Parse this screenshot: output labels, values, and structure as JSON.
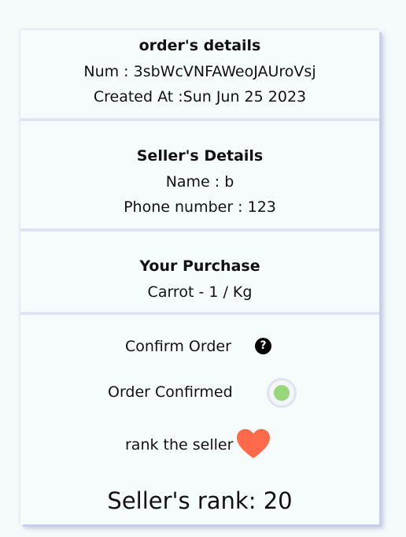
{
  "order": {
    "title": "order's details",
    "num_line": "Num : 3sbWcVNFAWeoJAUroVsj",
    "created_line": "Created At :Sun Jun 25 2023"
  },
  "seller": {
    "title": "Seller's Details",
    "name_line": "Name : b",
    "phone_line": "Phone number : 123"
  },
  "purchase": {
    "title": "Your Purchase",
    "item_line": "Carrot - 1 / Kg"
  },
  "actions": {
    "confirm_label": "Confirm Order",
    "help_glyph": "?",
    "confirmed_label": "Order Confirmed",
    "confirmed_on": true,
    "rank_label": "rank the seller",
    "rank_result": "Seller's rank: 20"
  },
  "icons": {
    "help": "question-circle-icon",
    "heart": "heart-icon"
  },
  "colors": {
    "toggle_on": "#97d77a",
    "heart": "#ff6b4a"
  }
}
